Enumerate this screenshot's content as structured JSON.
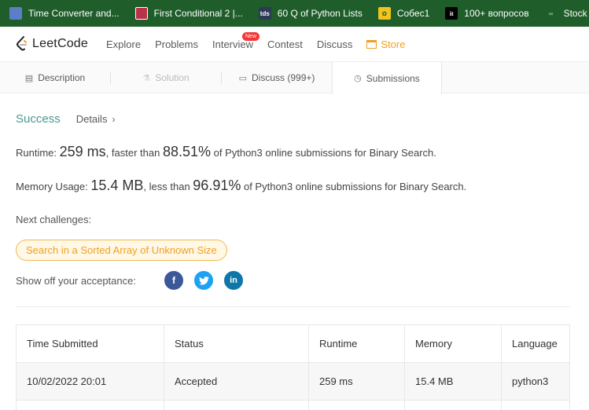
{
  "bookmarks": [
    {
      "label": "Time Converter and...",
      "icon": "clock-icon"
    },
    {
      "label": "First Conditional 2 |...",
      "icon": "crest-icon"
    },
    {
      "label": "60 Q of Python Lists",
      "icon": "tds-icon",
      "icon_text": "tds"
    },
    {
      "label": "Собес1",
      "icon": "leaf-icon",
      "icon_text": "✿"
    },
    {
      "label": "100+ вопросов",
      "icon": "it-icon",
      "icon_text": "it"
    },
    {
      "label": "Stock Buy",
      "icon": "glasses-icon",
      "icon_text": "∞"
    }
  ],
  "nav": {
    "logo": "LeetCode",
    "items": [
      "Explore",
      "Problems",
      "Interview",
      "Contest",
      "Discuss"
    ],
    "new_badge": "New",
    "store": "Store"
  },
  "tabs": {
    "description": "Description",
    "solution": "Solution",
    "discuss": "Discuss (999+)",
    "submissions": "Submissions"
  },
  "result": {
    "status": "Success",
    "details": "Details",
    "runtime_label": "Runtime: ",
    "runtime_value": "259 ms",
    "runtime_mid": ", faster than ",
    "runtime_pct": "88.51%",
    "runtime_tail": " of Python3 online submissions for Binary Search.",
    "memory_label": "Memory Usage: ",
    "memory_value": "15.4 MB",
    "memory_mid": ", less than ",
    "memory_pct": "96.91%",
    "memory_tail": " of Python3 online submissions for Binary Search.",
    "next_label": "Next challenges:",
    "challenge": "Search in a Sorted Array of Unknown Size",
    "share_label": "Show off your acceptance:"
  },
  "table": {
    "headers": [
      "Time Submitted",
      "Status",
      "Runtime",
      "Memory",
      "Language"
    ],
    "rows": [
      [
        "10/02/2022 20:01",
        "Accepted",
        "259 ms",
        "15.4 MB",
        "python3"
      ]
    ]
  },
  "colors": {
    "bookmark_bar": "#1f5d2a",
    "success": "#4a9a8f",
    "store": "#f0a020"
  }
}
